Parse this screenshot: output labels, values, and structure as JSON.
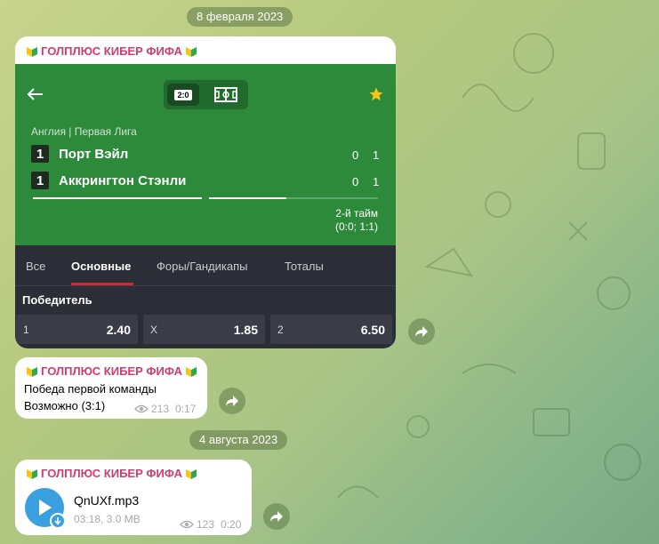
{
  "dates": {
    "first": "8 февраля 2023",
    "second": "4 августа 2023"
  },
  "channel": {
    "name": "ГОЛПЛЮС КИБЕР ФИФА"
  },
  "match": {
    "toggle_score": "2:0",
    "league": "Англия | Первая Лига",
    "team1": {
      "num": "1",
      "name": "Порт Вэйл",
      "s1": "0",
      "s2": "1"
    },
    "team2": {
      "num": "1",
      "name": "Аккрингтон Стэнли",
      "s1": "0",
      "s2": "1"
    },
    "half": "2-й тайм",
    "half_scores": "(0:0; 1:1)",
    "tabs": [
      "Все",
      "Основные",
      "Форы/Гандикапы",
      "Тоталы"
    ],
    "market": "Победитель",
    "odds": [
      {
        "label": "1",
        "value": "2.40"
      },
      {
        "label": "X",
        "value": "1.85"
      },
      {
        "label": "2",
        "value": "6.50"
      }
    ],
    "progress": {
      "team1_bar": 1.0,
      "team2_bar": 0.46
    }
  },
  "msg2": {
    "line1": "Победа первой команды",
    "line2": "Возможно (3:1)",
    "views": "213",
    "time": "0:17"
  },
  "msg3": {
    "file_name": "QnUXf.mp3",
    "file_meta": "03:18, 3.0 MB",
    "views": "123",
    "time": "0:20"
  },
  "colors": {
    "accent_green": "#2d8a3b",
    "sender": "#d13c6e",
    "play_blue": "#3aa0e0",
    "star": "#f5c518"
  }
}
